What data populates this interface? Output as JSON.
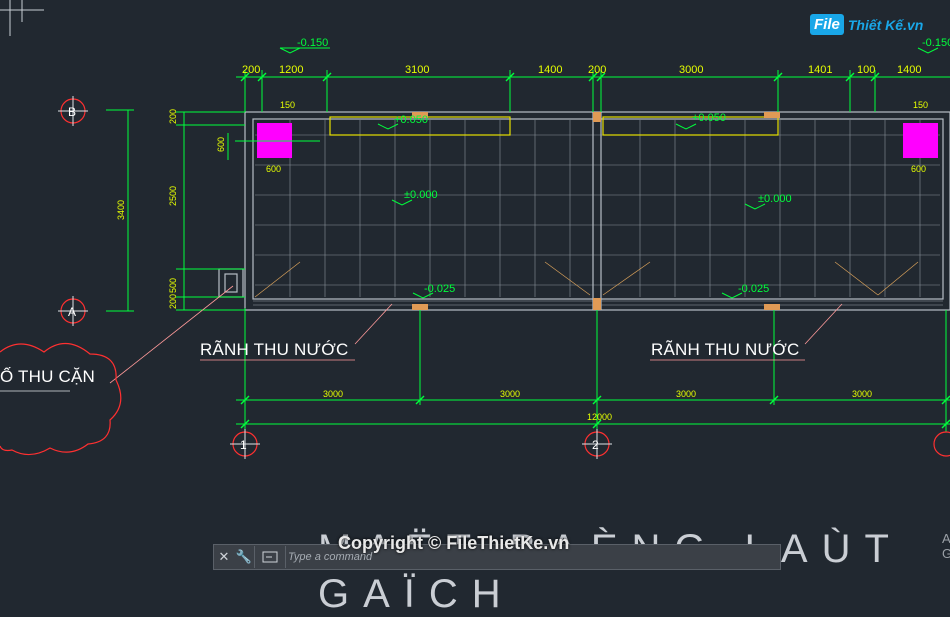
{
  "logo": {
    "file": "File",
    "rest": "Thiết Kế.vn"
  },
  "levels": {
    "top_left": "-0.150",
    "top_right": "-0.150",
    "raised_left": "+0.050",
    "raised_right": "+0.050",
    "floor_left": "±0.000",
    "floor_right": "±0.000",
    "gutter_left": "-0.025",
    "gutter_right": "-0.025"
  },
  "dims": {
    "top": [
      "200",
      "1200",
      "3100",
      "1400",
      "200",
      "3000",
      "1401",
      "100",
      "1400"
    ],
    "left_side": [
      "200",
      "2500",
      "500",
      "200"
    ],
    "total_height": "3400",
    "small_600": "600",
    "small_150": "150",
    "bottom_spans": [
      "3000",
      "3000",
      "3000",
      "3000"
    ],
    "bottom_total": "12000"
  },
  "axes": {
    "b": "B",
    "a": "A",
    "one": "1",
    "two": "2"
  },
  "labels": {
    "gutter_left": "RÃNH THU NƯỚC",
    "gutter_right": "RÃNH THU NƯỚC",
    "sump": "Ố THU CẶN"
  },
  "title": "MAËT BAÈNG LAÙT GAÏCH",
  "copyright": "Copyright © FileThietKe.vn",
  "command": {
    "placeholder": "Type a command",
    "close": "✕",
    "wrench": "🔧"
  },
  "corner_text": "A\nG",
  "colors": {
    "background": "#212830",
    "dim_green": "#00ff3c",
    "dim_text": "#e6ff00",
    "wall": "#b7bec6",
    "magenta": "#ff00ff",
    "grid": "#8a9199",
    "orange": "#e09a55"
  }
}
